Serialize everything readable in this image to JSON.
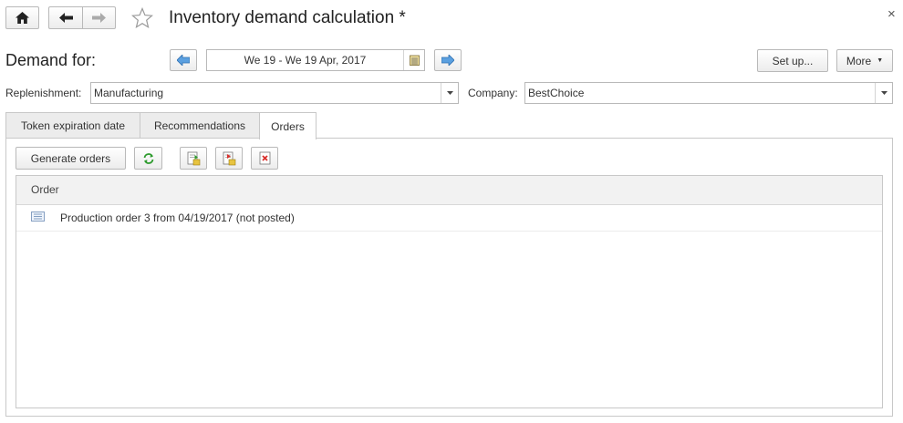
{
  "window": {
    "title": "Inventory demand calculation *",
    "close_glyph": "×"
  },
  "header": {
    "demand_label": "Demand for:",
    "period_value": "We 19 - We 19 Apr, 2017",
    "setup_label": "Set up...",
    "more_label": "More"
  },
  "filters": {
    "replenishment_label": "Replenishment:",
    "replenishment_value": "Manufacturing",
    "company_label": "Company:",
    "company_value": "BestChoice"
  },
  "tabs": [
    {
      "label": "Token expiration date",
      "active": false
    },
    {
      "label": "Recommendations",
      "active": false
    },
    {
      "label": "Orders",
      "active": true
    }
  ],
  "toolbar": {
    "generate_label": "Generate orders"
  },
  "orders_table": {
    "columns": [
      "Order"
    ],
    "rows": [
      {
        "order": "Production order 3 from 04/19/2017 (not posted)"
      }
    ]
  },
  "colors": {
    "accent_blue": "#4a90d9",
    "refresh_green": "#2e9b2e",
    "delete_red": "#d9302c"
  }
}
